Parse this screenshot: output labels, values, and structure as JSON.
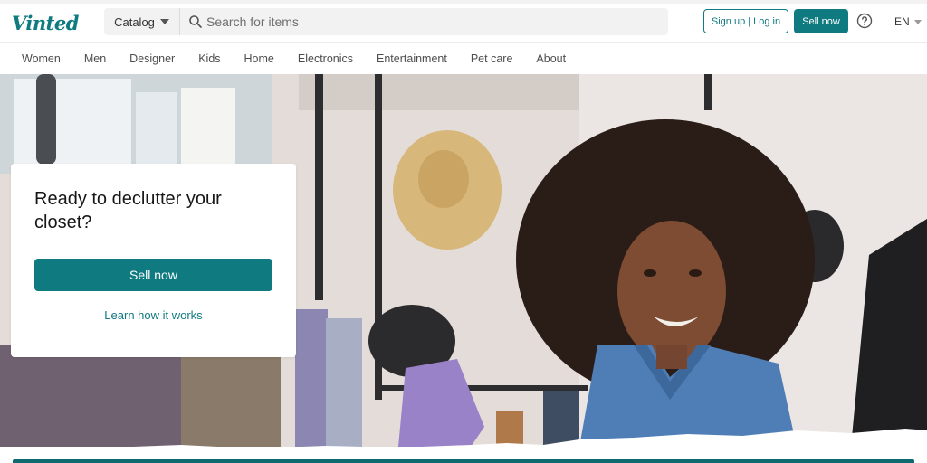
{
  "brand": {
    "logo_text": "Vinted",
    "accent": "#0f7a80"
  },
  "header": {
    "catalog_label": "Catalog",
    "search_placeholder": "Search for items",
    "signup_label": "Sign up | Log in",
    "sell_label": "Sell now",
    "language": "EN"
  },
  "nav": {
    "items": [
      {
        "label": "Women"
      },
      {
        "label": "Men"
      },
      {
        "label": "Designer"
      },
      {
        "label": "Kids"
      },
      {
        "label": "Home"
      },
      {
        "label": "Electronics"
      },
      {
        "label": "Entertainment"
      },
      {
        "label": "Pet care"
      },
      {
        "label": "About"
      }
    ]
  },
  "hero": {
    "title": "Ready to declutter your closet?",
    "sell_button": "Sell now",
    "learn_link": "Learn how it works"
  },
  "icons": {
    "search": "search-icon",
    "help": "help-icon",
    "catalog_caret": "chevron-down-icon"
  }
}
